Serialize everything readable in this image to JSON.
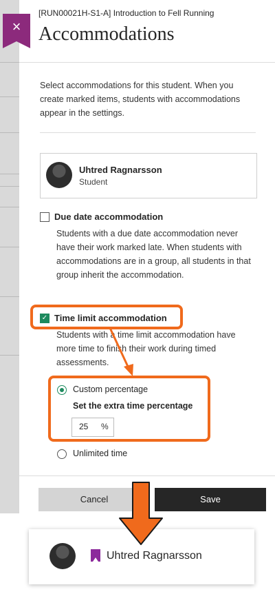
{
  "header": {
    "course": "[RUN00021H-S1-A] Introduction to Fell Running",
    "title": "Accommodations",
    "close_symbol": "×"
  },
  "intro": "Select accommodations for this student. When you create marked items, students with accommodations appear in the settings.",
  "student": {
    "name": "Uhtred Ragnarsson",
    "role": "Student"
  },
  "options": {
    "due_date": {
      "label": "Due date accommodation",
      "checked": false,
      "description": "Students with a due date accommodation never have their work marked late. When students with accommodations are in a group, all students in that group inherit the accommodation."
    },
    "time_limit": {
      "label": "Time limit accommodation",
      "checked": true,
      "check_symbol": "✓",
      "description": "Students with a time limit accommodation have more time to finish their work during timed assessments."
    }
  },
  "time_options": {
    "custom": {
      "label": "Custom percentage",
      "selected": true
    },
    "extra_label": "Set the extra time percentage",
    "percent_value": "25",
    "percent_unit": "%",
    "unlimited": {
      "label": "Unlimited time",
      "selected": false
    }
  },
  "footer": {
    "cancel_label": "Cancel",
    "save_label": "Save"
  },
  "inset": {
    "name": "Uhtred Ragnarsson",
    "flag_icon": "bookmark-flag-icon"
  },
  "colors": {
    "accent": "#8c2a7c",
    "check_green": "#1d8a5e",
    "highlight_orange": "#f06a1c",
    "save_button": "#262626",
    "cancel_button": "#d4d4d4"
  }
}
